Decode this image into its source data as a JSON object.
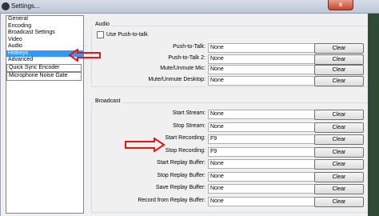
{
  "window": {
    "title": "Settings...",
    "close_glyph": "x"
  },
  "sidebar": {
    "items": [
      {
        "label": "General"
      },
      {
        "label": "Encoding"
      },
      {
        "label": "Broadcast Settings"
      },
      {
        "label": "Video"
      },
      {
        "label": "Audio"
      },
      {
        "label": "Hotkeys"
      },
      {
        "label": "Advanced"
      },
      {
        "label": "Quick Sync Encoder"
      },
      {
        "label": "Microphone Noise Gate"
      }
    ],
    "selected": "Hotkeys"
  },
  "audio": {
    "group_label": "Audio",
    "push_to_talk_checkbox": "Use Push-to-talk",
    "rows": [
      {
        "label": "Push-to-Talk:",
        "value": "None",
        "button": "Clear"
      },
      {
        "label": "Push-to-Talk 2:",
        "value": "None",
        "button": "Clear"
      },
      {
        "label": "Mute/Unmute Mic:",
        "value": "None",
        "button": "Clear"
      },
      {
        "label": "Mute/Unmute Desktop:",
        "value": "None",
        "button": "Clear"
      }
    ]
  },
  "broadcast": {
    "group_label": "Broadcast",
    "rows": [
      {
        "label": "Start Stream:",
        "value": "None",
        "button": "Clear"
      },
      {
        "label": "Stop Stream:",
        "value": "None",
        "button": "Clear"
      },
      {
        "label": "Start Recording:",
        "value": "F9",
        "button": "Clear"
      },
      {
        "label": "Stop Recording:",
        "value": "F9",
        "button": "Clear"
      },
      {
        "label": "Start Replay Buffer:",
        "value": "None",
        "button": "Clear"
      },
      {
        "label": "Stop Replay Buffer:",
        "value": "None",
        "button": "Clear"
      },
      {
        "label": "Save Replay Buffer:",
        "value": "None",
        "button": "Clear"
      },
      {
        "label": "Record from Replay Buffer:",
        "value": "None",
        "button": "Clear"
      }
    ]
  },
  "colors": {
    "selection": "#3399ff",
    "arrow": "#e01818"
  }
}
